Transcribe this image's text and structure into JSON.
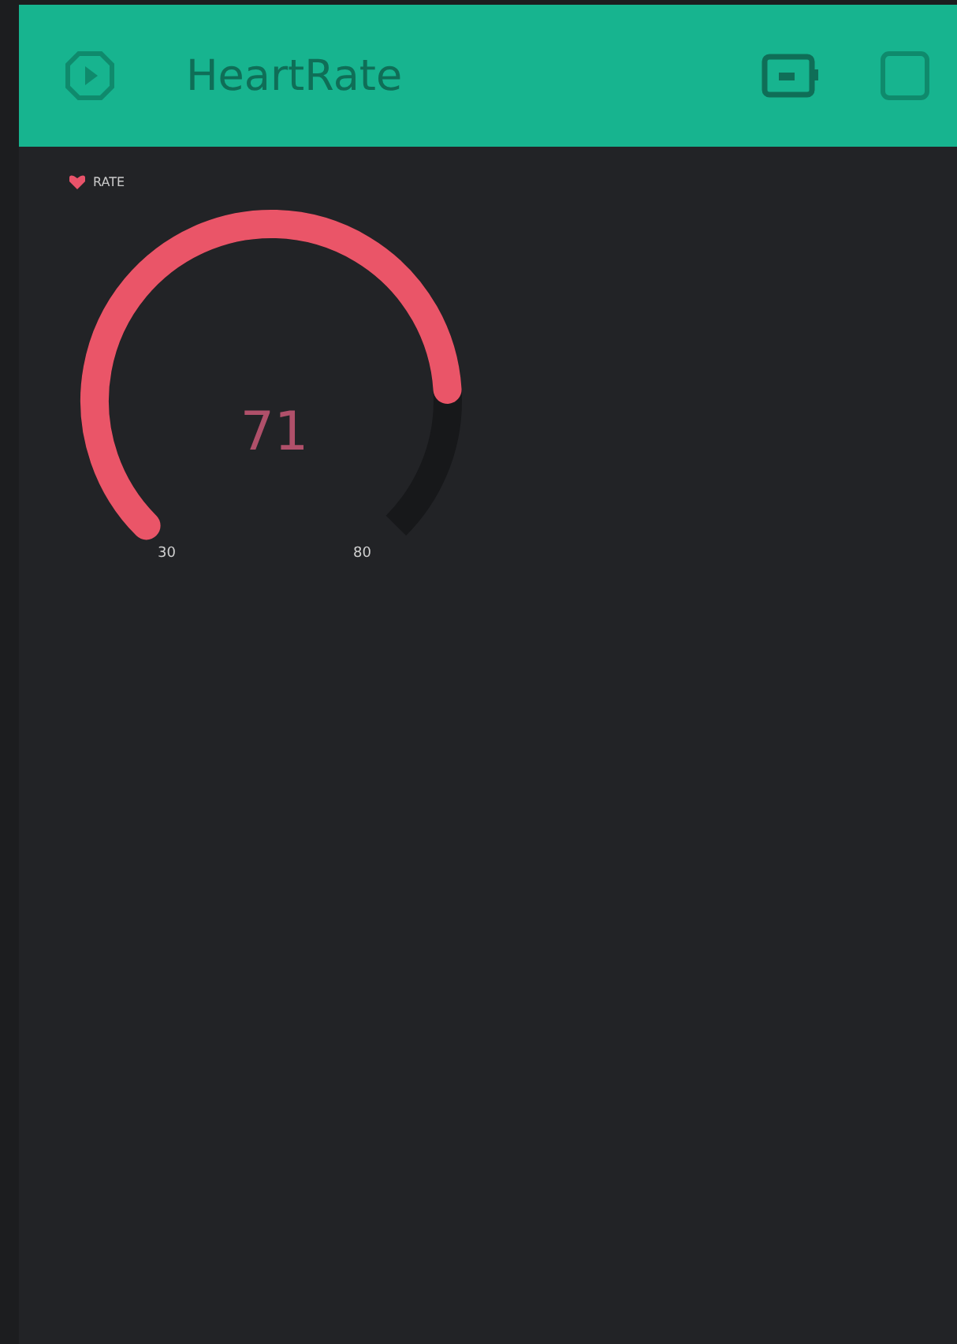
{
  "header": {
    "title": "HeartRate"
  },
  "gauge": {
    "label": "RATE",
    "value": "71",
    "min": "30",
    "max": "80"
  }
}
